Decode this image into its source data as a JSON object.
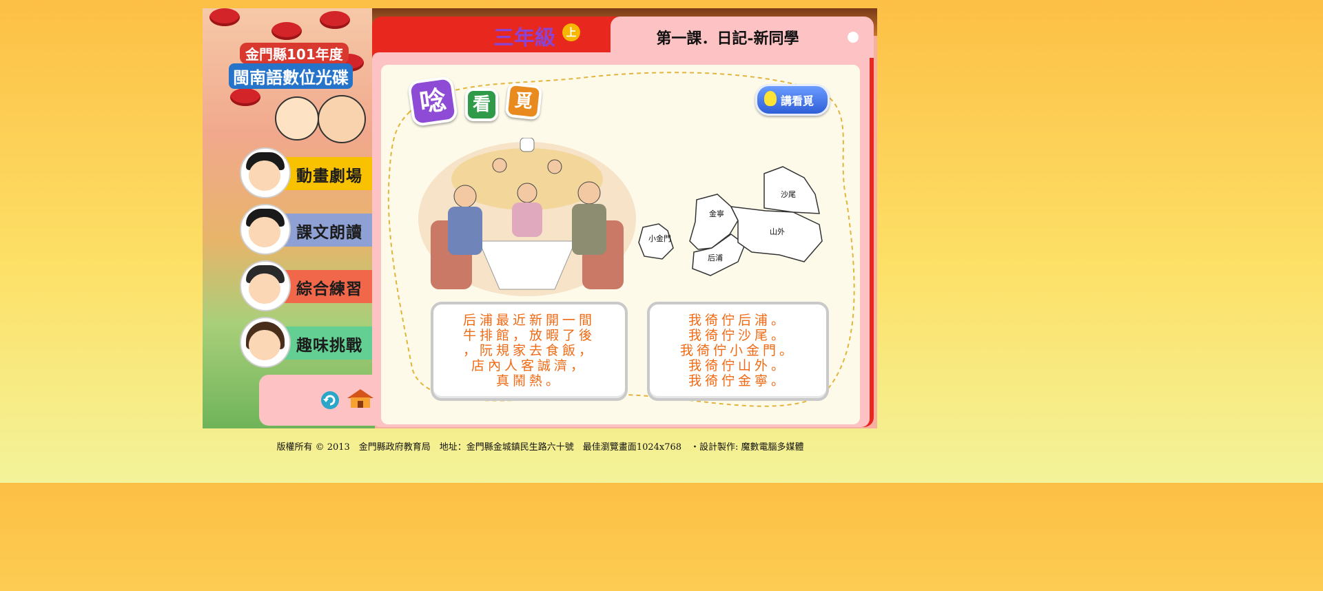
{
  "header": {
    "logo_line1": "金門縣101年度",
    "logo_line2": "閩南語數位光碟",
    "grade": "三年級",
    "grade_badge": "上",
    "lesson_title": "第一課．日記-新同學"
  },
  "menu": [
    {
      "label": "動畫劇場",
      "color": "#f9c200"
    },
    {
      "label": "課文朗讀",
      "color": "#8ea0d4"
    },
    {
      "label": "綜合練習",
      "color": "#f0674a"
    },
    {
      "label": "趣味挑戰",
      "color": "#63cf93"
    }
  ],
  "section_title": [
    "唸",
    "看",
    "覓"
  ],
  "speak_button": "講看覓",
  "map_labels": {
    "shawei": "沙尾",
    "jinning": "金寧",
    "shanwai": "山外",
    "xiaojinmen": "小金門",
    "houpu": "后浦"
  },
  "text_left": [
    "后浦最近新開一間",
    "牛排館，放暇了後",
    "，阮規家去食飯，",
    "店內人客誠濟，",
    "真鬧熱。"
  ],
  "text_right": [
    "我徛佇后浦。",
    "我徛佇沙尾。",
    "我徛佇小金門。",
    "我徛佇山外。",
    "我徛佇金寧。"
  ],
  "footer": "版權所有 © 2013　金門縣政府教育局　地址：金門縣金城鎮民生路六十號　最佳瀏覽畫面1024x768　‧設計製作: 魔數電腦多媒體",
  "icons": [
    "back-arrow-icon",
    "home-icon",
    "lightbulb-icon"
  ]
}
